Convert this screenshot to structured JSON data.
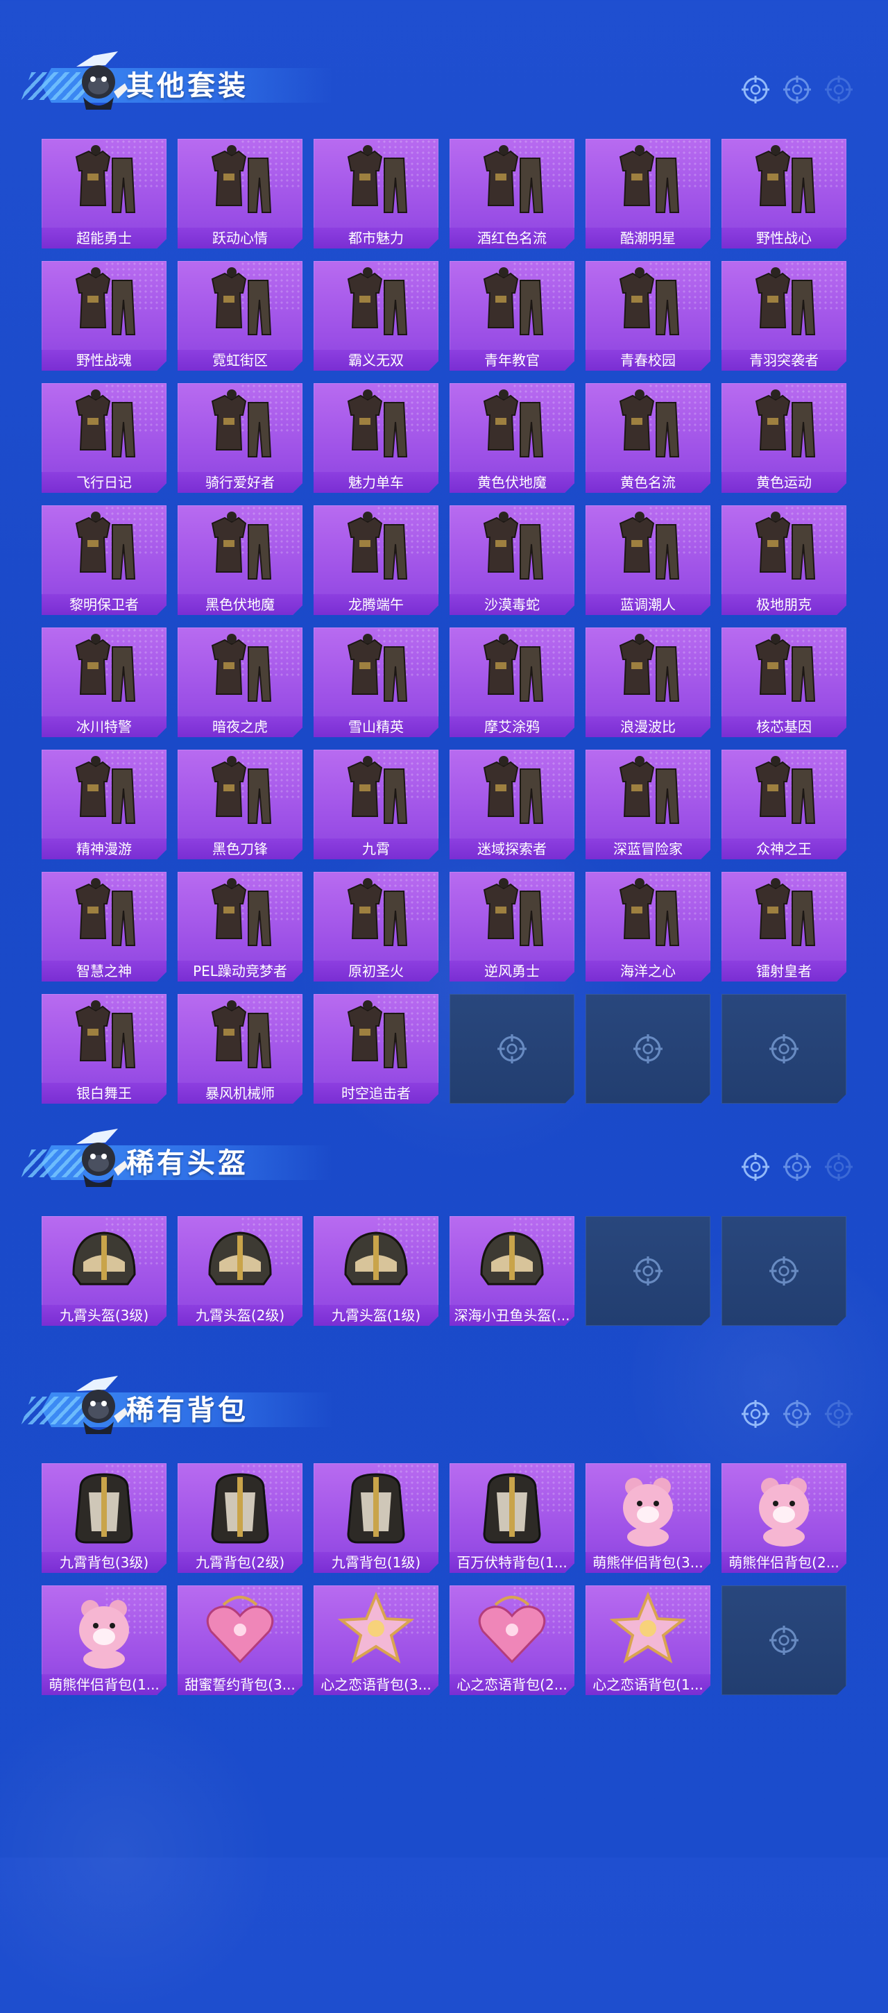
{
  "colors": {
    "background": "#1f4fd0",
    "tile_purple": "#9b4fe6",
    "label_purple": "#7a2ed3",
    "empty_slot": "#29477d",
    "banner_blue": "#3d8cf5"
  },
  "sections": [
    {
      "title": "其他套装",
      "items": [
        {
          "name": "超能勇士",
          "icon": "outfit-icon"
        },
        {
          "name": "跃动心情",
          "icon": "outfit-icon"
        },
        {
          "name": "都市魅力",
          "icon": "outfit-icon"
        },
        {
          "name": "酒红色名流",
          "icon": "outfit-icon"
        },
        {
          "name": "酷潮明星",
          "icon": "outfit-icon"
        },
        {
          "name": "野性战心",
          "icon": "outfit-icon"
        },
        {
          "name": "野性战魂",
          "icon": "outfit-icon"
        },
        {
          "name": "霓虹街区",
          "icon": "outfit-icon"
        },
        {
          "name": "霸义无双",
          "icon": "outfit-icon"
        },
        {
          "name": "青年教官",
          "icon": "outfit-icon"
        },
        {
          "name": "青春校园",
          "icon": "outfit-icon"
        },
        {
          "name": "青羽突袭者",
          "icon": "outfit-icon"
        },
        {
          "name": "飞行日记",
          "icon": "outfit-icon"
        },
        {
          "name": "骑行爱好者",
          "icon": "outfit-icon"
        },
        {
          "name": "魅力单车",
          "icon": "outfit-icon"
        },
        {
          "name": "黄色伏地魔",
          "icon": "outfit-icon"
        },
        {
          "name": "黄色名流",
          "icon": "outfit-icon"
        },
        {
          "name": "黄色运动",
          "icon": "outfit-icon"
        },
        {
          "name": "黎明保卫者",
          "icon": "outfit-icon"
        },
        {
          "name": "黑色伏地魔",
          "icon": "outfit-icon"
        },
        {
          "name": "龙腾端午",
          "icon": "outfit-icon"
        },
        {
          "name": "沙漠毒蛇",
          "icon": "outfit-icon"
        },
        {
          "name": "蓝调潮人",
          "icon": "outfit-icon"
        },
        {
          "name": "极地朋克",
          "icon": "outfit-icon"
        },
        {
          "name": "冰川特警",
          "icon": "outfit-icon"
        },
        {
          "name": "暗夜之虎",
          "icon": "outfit-icon"
        },
        {
          "name": "雪山精英",
          "icon": "outfit-icon"
        },
        {
          "name": "摩艾涂鸦",
          "icon": "outfit-icon"
        },
        {
          "name": "浪漫波比",
          "icon": "outfit-icon"
        },
        {
          "name": "核芯基因",
          "icon": "outfit-icon"
        },
        {
          "name": "精神漫游",
          "icon": "outfit-icon"
        },
        {
          "name": "黑色刀锋",
          "icon": "outfit-icon"
        },
        {
          "name": "九霄",
          "icon": "outfit-icon"
        },
        {
          "name": "迷域探索者",
          "icon": "outfit-icon"
        },
        {
          "name": "深蓝冒险家",
          "icon": "outfit-icon"
        },
        {
          "name": "众神之王",
          "icon": "outfit-icon"
        },
        {
          "name": "智慧之神",
          "icon": "outfit-icon"
        },
        {
          "name": "PEL躁动竞梦者",
          "icon": "outfit-icon"
        },
        {
          "name": "原初圣火",
          "icon": "outfit-icon"
        },
        {
          "name": "逆风勇士",
          "icon": "outfit-icon"
        },
        {
          "name": "海洋之心",
          "icon": "outfit-icon"
        },
        {
          "name": "镭射皇者",
          "icon": "outfit-icon"
        },
        {
          "name": "银白舞王",
          "icon": "outfit-icon"
        },
        {
          "name": "暴风机械师",
          "icon": "outfit-icon"
        },
        {
          "name": "时空追击者",
          "icon": "outfit-icon"
        }
      ],
      "empty_slots": 3
    },
    {
      "title": "稀有头盔",
      "items": [
        {
          "name": "九霄头盔(3级)",
          "icon": "helmet-icon"
        },
        {
          "name": "九霄头盔(2级)",
          "icon": "helmet-icon"
        },
        {
          "name": "九霄头盔(1级)",
          "icon": "helmet-icon"
        },
        {
          "name": "深海小丑鱼头盔(...",
          "icon": "helmet-icon"
        }
      ],
      "empty_slots": 2
    },
    {
      "title": "稀有背包",
      "items": [
        {
          "name": "九霄背包(3级)",
          "icon": "backpack-icon"
        },
        {
          "name": "九霄背包(2级)",
          "icon": "backpack-icon"
        },
        {
          "name": "九霄背包(1级)",
          "icon": "backpack-icon"
        },
        {
          "name": "百万伏特背包(1...",
          "icon": "backpack-icon"
        },
        {
          "name": "萌熊伴侣背包(3...",
          "icon": "bear-backpack-icon"
        },
        {
          "name": "萌熊伴侣背包(2...",
          "icon": "bear-backpack-icon"
        },
        {
          "name": "萌熊伴侣背包(1...",
          "icon": "bear-backpack-icon"
        },
        {
          "name": "甜蜜誓约背包(3...",
          "icon": "heart-backpack-icon"
        },
        {
          "name": "心之恋语背包(3...",
          "icon": "star-backpack-icon"
        },
        {
          "name": "心之恋语背包(2...",
          "icon": "heart-backpack-icon"
        },
        {
          "name": "心之恋语背包(1...",
          "icon": "star-backpack-icon"
        }
      ],
      "empty_slots": 1
    }
  ]
}
